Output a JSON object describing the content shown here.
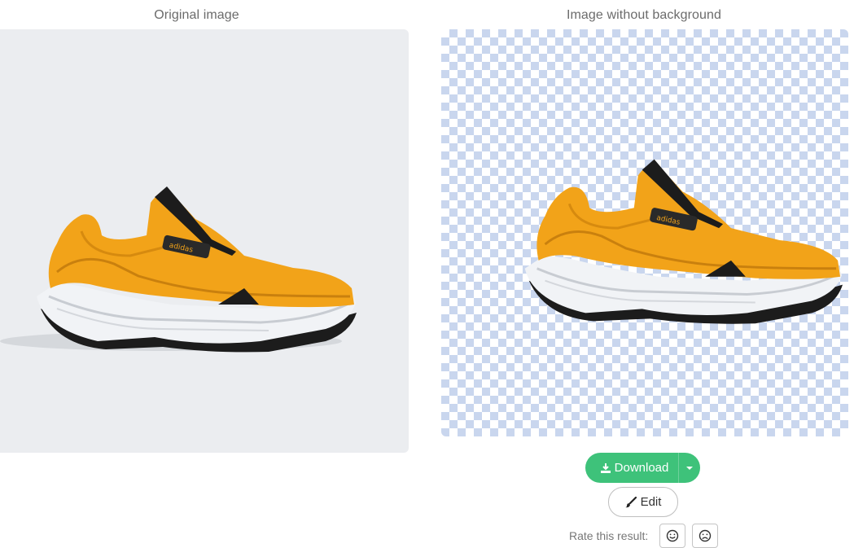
{
  "left_panel": {
    "title": "Original image"
  },
  "right_panel": {
    "title": "Image without background"
  },
  "actions": {
    "download_label": "Download",
    "download_icon": "download-icon",
    "dropdown_icon": "caret-down-icon",
    "edit_label": "Edit",
    "edit_icon": "brush-icon",
    "rate_label": "Rate this result:",
    "rate_good_icon": "smile-icon",
    "rate_bad_icon": "frown-icon"
  },
  "colors": {
    "accent": "#3ec27a",
    "original_background": "#ebedf0",
    "checker": "#c9d6ee",
    "shoe_orange": "#f2a319"
  },
  "image": {
    "subject": "orange sneaker",
    "brand_tag": "adidas"
  }
}
